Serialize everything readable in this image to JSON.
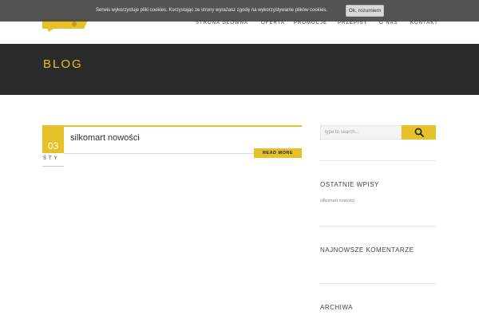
{
  "cookie": {
    "message": "Serwis wykorzystuje pliki cookies. Korzystając ze strony wyrażasz zgodę na wykorzystywanie plików cookies.",
    "accept_label": "Ok, rozumiem"
  },
  "nav": {
    "items": [
      {
        "label": "Strona główna"
      },
      {
        "label": "Oferta"
      },
      {
        "label": "Promocje"
      },
      {
        "label": "Przepisy"
      },
      {
        "label": "O nas"
      },
      {
        "label": "Kontakt"
      }
    ]
  },
  "banner": {
    "title": "Blog"
  },
  "post": {
    "day": "03",
    "month": "STY",
    "title": "silkomart nowości",
    "read_more_label": "Read more"
  },
  "sidebar": {
    "search_placeholder": "type to search...",
    "recent_heading": "Ostatnie wpisy",
    "recent_items": [
      {
        "label": "silkomart nowości"
      }
    ],
    "comments_heading": "Najnowsze komentarze",
    "archive_heading": "Archiwa"
  },
  "colors": {
    "accent": "#e6c229",
    "banner_bg": "#2a2a2a",
    "cookie_bg": "#3c3c3c"
  }
}
